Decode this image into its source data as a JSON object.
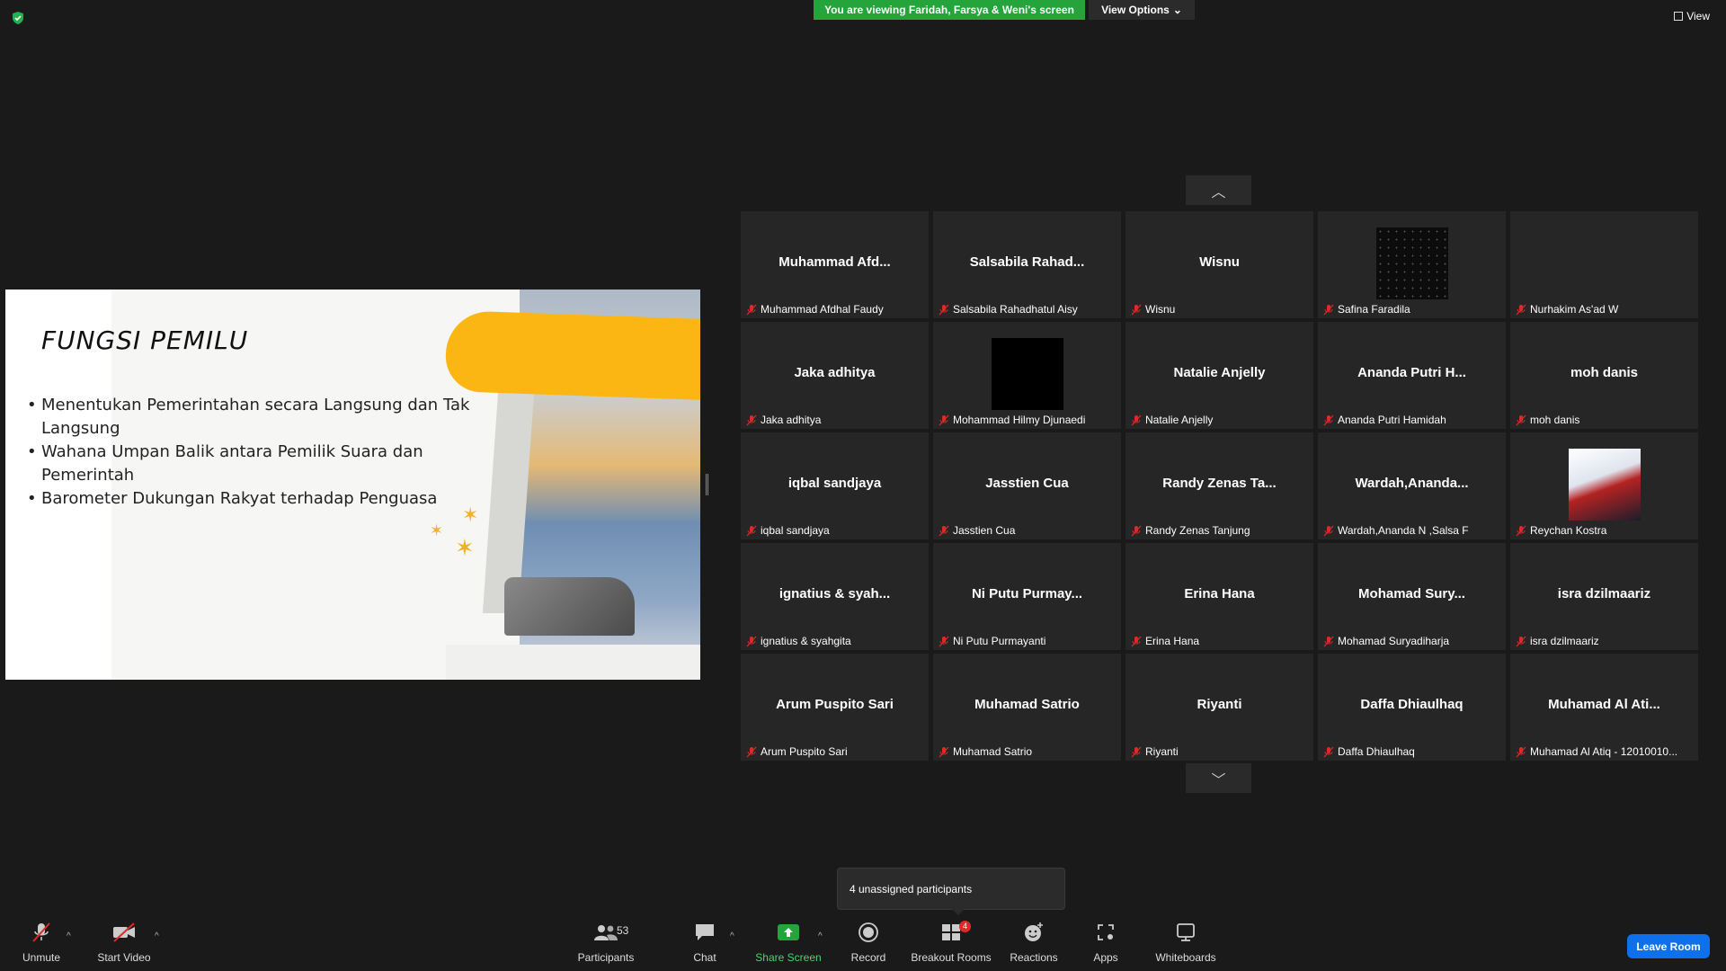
{
  "banner": {
    "text": "You are viewing Faridah, Farsya & Weni's screen",
    "color": "#24a43a"
  },
  "view_options": {
    "label": "View Options"
  },
  "view_button": {
    "label": "View"
  },
  "slide": {
    "title": "FUNGSI PEMILU",
    "bullets": [
      "Menentukan Pemerintahan secara Langsung dan Tak Langsung",
      "Wahana Umpan Balik antara Pemilik Suara dan Pemerintah",
      "Barometer Dukungan Rakyat terhadap Penguasa"
    ]
  },
  "gallery": {
    "tiles": [
      {
        "big": "Muhammad  Afd...",
        "name": "Muhammad Afdhal Faudy",
        "thumb": ""
      },
      {
        "big": "Salsabila  Rahad...",
        "name": "Salsabila Rahadhatul Aisy",
        "thumb": ""
      },
      {
        "big": "Wisnu",
        "name": "Wisnu",
        "thumb": ""
      },
      {
        "big": "",
        "name": "Safina Faradila",
        "thumb": "stars"
      },
      {
        "big": "",
        "name": "Nurhakim As'ad W",
        "thumb": ""
      },
      {
        "big": "Jaka adhitya",
        "name": "Jaka adhitya",
        "thumb": ""
      },
      {
        "big": "",
        "name": "Mohammad Hilmy Djunaedi",
        "thumb": "black"
      },
      {
        "big": "Natalie Anjelly",
        "name": "Natalie Anjelly",
        "thumb": ""
      },
      {
        "big": "Ananda  Putri  H...",
        "name": "Ananda Putri Hamidah",
        "thumb": ""
      },
      {
        "big": "moh danis",
        "name": "moh danis",
        "thumb": ""
      },
      {
        "big": "iqbal sandjaya",
        "name": "iqbal sandjaya",
        "thumb": ""
      },
      {
        "big": "Jasstien Cua",
        "name": "Jasstien Cua",
        "thumb": ""
      },
      {
        "big": "Randy  Zenas  Ta...",
        "name": "Randy Zenas Tanjung",
        "thumb": ""
      },
      {
        "big": "Wardah,Ananda...",
        "name": "Wardah,Ananda N ,Salsa F",
        "thumb": ""
      },
      {
        "big": "",
        "name": "Reychan Kostra",
        "thumb": "racer"
      },
      {
        "big": "ignatius  &  syah...",
        "name": "ignatius & syahgita",
        "thumb": ""
      },
      {
        "big": "Ni  Putu  Purmay...",
        "name": "Ni Putu Purmayanti",
        "thumb": ""
      },
      {
        "big": "Erina Hana",
        "name": "Erina Hana",
        "thumb": ""
      },
      {
        "big": "Mohamad  Sury...",
        "name": "Mohamad Suryadiharja",
        "thumb": ""
      },
      {
        "big": "isra dzilmaariz",
        "name": "isra dzilmaariz",
        "thumb": ""
      },
      {
        "big": "Arum Puspito Sari",
        "name": "Arum Puspito Sari",
        "thumb": ""
      },
      {
        "big": "Muhamad Satrio",
        "name": "Muhamad Satrio",
        "thumb": ""
      },
      {
        "big": "Riyanti",
        "name": "Riyanti",
        "thumb": ""
      },
      {
        "big": "Daffa Dhiaulhaq",
        "name": "Daffa Dhiaulhaq",
        "thumb": ""
      },
      {
        "big": "Muhamad  Al  Ati...",
        "name": "Muhamad Al Atiq - 12010010...",
        "thumb": ""
      }
    ]
  },
  "popup": {
    "text": "4 unassigned participants"
  },
  "toolbar": {
    "unmute": "Unmute",
    "start_video": "Start Video",
    "participants": "Participants",
    "participants_count": "53",
    "chat": "Chat",
    "share_screen": "Share Screen",
    "record": "Record",
    "breakout_rooms": "Breakout Rooms",
    "breakout_badge": "4",
    "reactions": "Reactions",
    "apps": "Apps",
    "whiteboards": "Whiteboards",
    "leave_room": "Leave Room"
  },
  "colors": {
    "accent_green": "#24a43a",
    "leave_blue": "#0e71eb",
    "mute_red": "#e02828",
    "slide_yellow": "#fbb614"
  }
}
